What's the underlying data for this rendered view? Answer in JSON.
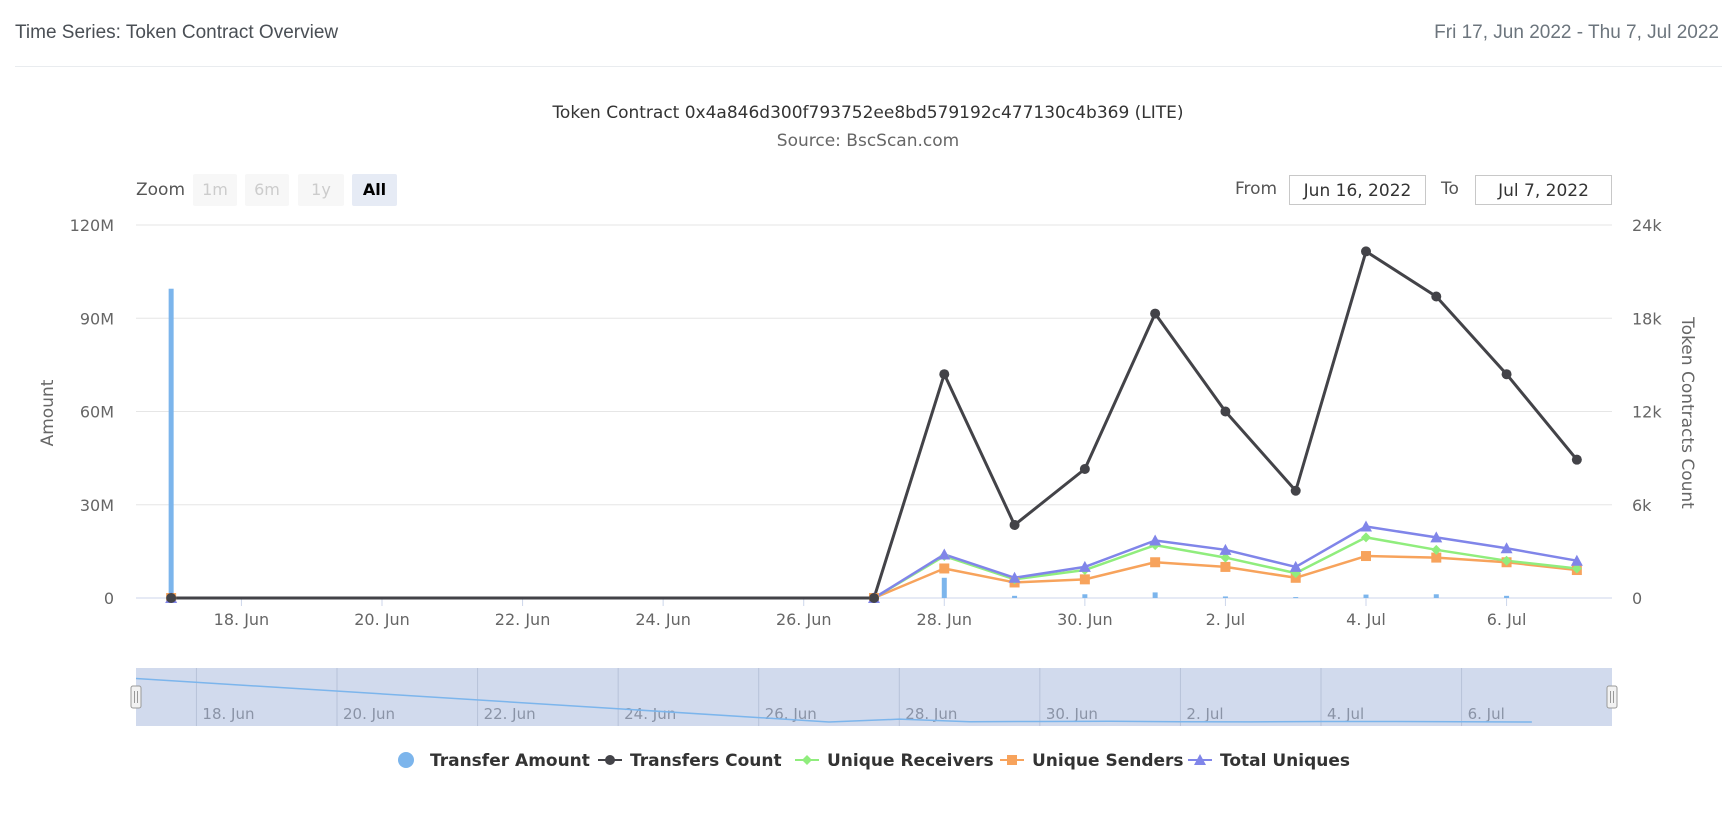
{
  "header": {
    "title": "Time Series: Token Contract Overview",
    "date_range": "Fri 17, Jun 2022 - Thu 7, Jul 2022"
  },
  "range_selector": {
    "zoom_label": "Zoom",
    "buttons": [
      "1m",
      "6m",
      "1y",
      "All"
    ],
    "active": "All",
    "from_label": "From",
    "from_value": "Jun 16, 2022",
    "to_label": "To",
    "to_value": "Jul 7, 2022"
  },
  "colors": {
    "transfer_amount": "#7cb5ec",
    "transfers_count": "#434348",
    "unique_receivers": "#90ed7d",
    "unique_senders": "#f7a35c",
    "total_uniques": "#8085e9",
    "navigator_fill": "#ccd6eb"
  },
  "chart_data": {
    "type": "line",
    "title": "Token Contract 0x4a846d300f793752ee8bd579192c477130c4b369 (LITE)",
    "subtitle": "Source: BscScan.com",
    "x": [
      "2022-06-17",
      "2022-06-27",
      "2022-06-28",
      "2022-06-29",
      "2022-06-30",
      "2022-07-01",
      "2022-07-02",
      "2022-07-03",
      "2022-07-04",
      "2022-07-05",
      "2022-07-06",
      "2022-07-07"
    ],
    "x_ticks": [
      "18. Jun",
      "20. Jun",
      "22. Jun",
      "24. Jun",
      "26. Jun",
      "28. Jun",
      "30. Jun",
      "2. Jul",
      "4. Jul",
      "6. Jul"
    ],
    "y_left": {
      "label": "Amount",
      "ticks": [
        "0",
        "30M",
        "60M",
        "90M",
        "120M"
      ],
      "range": [
        0,
        120000000
      ]
    },
    "y_right": {
      "label": "Token Contracts Count",
      "ticks": [
        "0",
        "6k",
        "12k",
        "18k",
        "24k"
      ],
      "range": [
        0,
        24000
      ]
    },
    "series": [
      {
        "name": "Transfer Amount",
        "axis": "left",
        "kind": "column",
        "values": [
          99500000,
          0,
          6500000,
          700000,
          1200000,
          1800000,
          500000,
          300000,
          1100000,
          1200000,
          700000,
          0
        ]
      },
      {
        "name": "Transfers Count",
        "axis": "right",
        "kind": "line",
        "marker": "circle",
        "values": [
          0,
          0,
          14400,
          4700,
          8300,
          18300,
          12000,
          6900,
          22300,
          19400,
          14400,
          8900
        ]
      },
      {
        "name": "Unique Receivers",
        "axis": "right",
        "kind": "line",
        "marker": "diamond",
        "values": [
          0,
          0,
          2700,
          1200,
          1800,
          3400,
          2600,
          1600,
          3900,
          3100,
          2400,
          1900
        ]
      },
      {
        "name": "Unique Senders",
        "axis": "right",
        "kind": "line",
        "marker": "square",
        "values": [
          0,
          0,
          1900,
          1000,
          1200,
          2300,
          2000,
          1300,
          2700,
          2600,
          2300,
          1800
        ]
      },
      {
        "name": "Total Uniques",
        "axis": "right",
        "kind": "line",
        "marker": "triangle",
        "values": [
          0,
          0,
          2800,
          1300,
          2000,
          3700,
          3100,
          2000,
          4600,
          3900,
          3200,
          2400
        ]
      }
    ],
    "navigator_x_ticks": [
      "18. Jun",
      "20. Jun",
      "22. Jun",
      "24. Jun",
      "26. Jun",
      "28. Jun",
      "30. Jun",
      "2. Jul",
      "4. Jul",
      "6. Jul"
    ],
    "grid": true,
    "legend_position": "bottom-center"
  }
}
